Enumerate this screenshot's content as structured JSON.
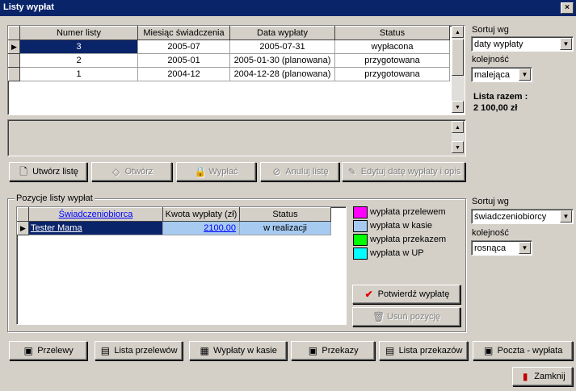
{
  "window": {
    "title": "Listy wypłat",
    "close_glyph": "×"
  },
  "lists_grid": {
    "columns": [
      "Numer listy",
      "Miesiąc świadczenia",
      "Data wypłaty",
      "Status"
    ],
    "rows": [
      {
        "num": "3",
        "month": "2005-07",
        "date": "2005-07-31",
        "status": "wypłacona"
      },
      {
        "num": "2",
        "month": "2005-01",
        "date": "2005-01-30 (planowana)",
        "status": "przygotowana"
      },
      {
        "num": "1",
        "month": "2004-12",
        "date": "2004-12-28 (planowana)",
        "status": "przygotowana"
      }
    ]
  },
  "sort_top": {
    "sort_label": "Sortuj wg",
    "sort_value": "daty wypłaty",
    "order_label": "kolejność",
    "order_value": "malejąca",
    "total_label": "Lista razem :",
    "total_value": "2 100,00 zł"
  },
  "list_actions": {
    "create": "Utwórz listę",
    "open": "Otwórz",
    "pay": "Wypłać",
    "cancel": "Anuluj listę",
    "edit": "Edytuj datę wypłaty i opis"
  },
  "positions": {
    "group_title": "Pozycje listy wypłat",
    "columns": [
      "Świadczeniobiorca",
      "Kwota wypłaty (zł)",
      "Status"
    ],
    "rows": [
      {
        "beneficiary": "Tester Mama",
        "amount": "2100,00",
        "status": "w realizacji"
      }
    ],
    "legend": [
      {
        "label": "wypłata przelewem",
        "color": "#ff00ff"
      },
      {
        "label": "wypłata w kasie",
        "color": "#a6caf0"
      },
      {
        "label": "wypłata przekazem",
        "color": "#00ff00"
      },
      {
        "label": "wypłata w UP",
        "color": "#00ffff"
      }
    ],
    "confirm": "Potwierdź wypłatę",
    "remove": "Usuń pozycję"
  },
  "sort_bottom": {
    "sort_label": "Sortuj wg",
    "sort_value": "świadczeniobiorcy",
    "order_label": "kolejność",
    "order_value": "rosnąca"
  },
  "bottom_buttons": {
    "transfers": "Przelewy",
    "transfer_list": "Lista przelewów",
    "cash": "Wypłaty w kasie",
    "money_orders": "Przekazy",
    "money_order_list": "Lista przekazów",
    "post": "Poczta - wypłata",
    "close": "Zamknij"
  }
}
